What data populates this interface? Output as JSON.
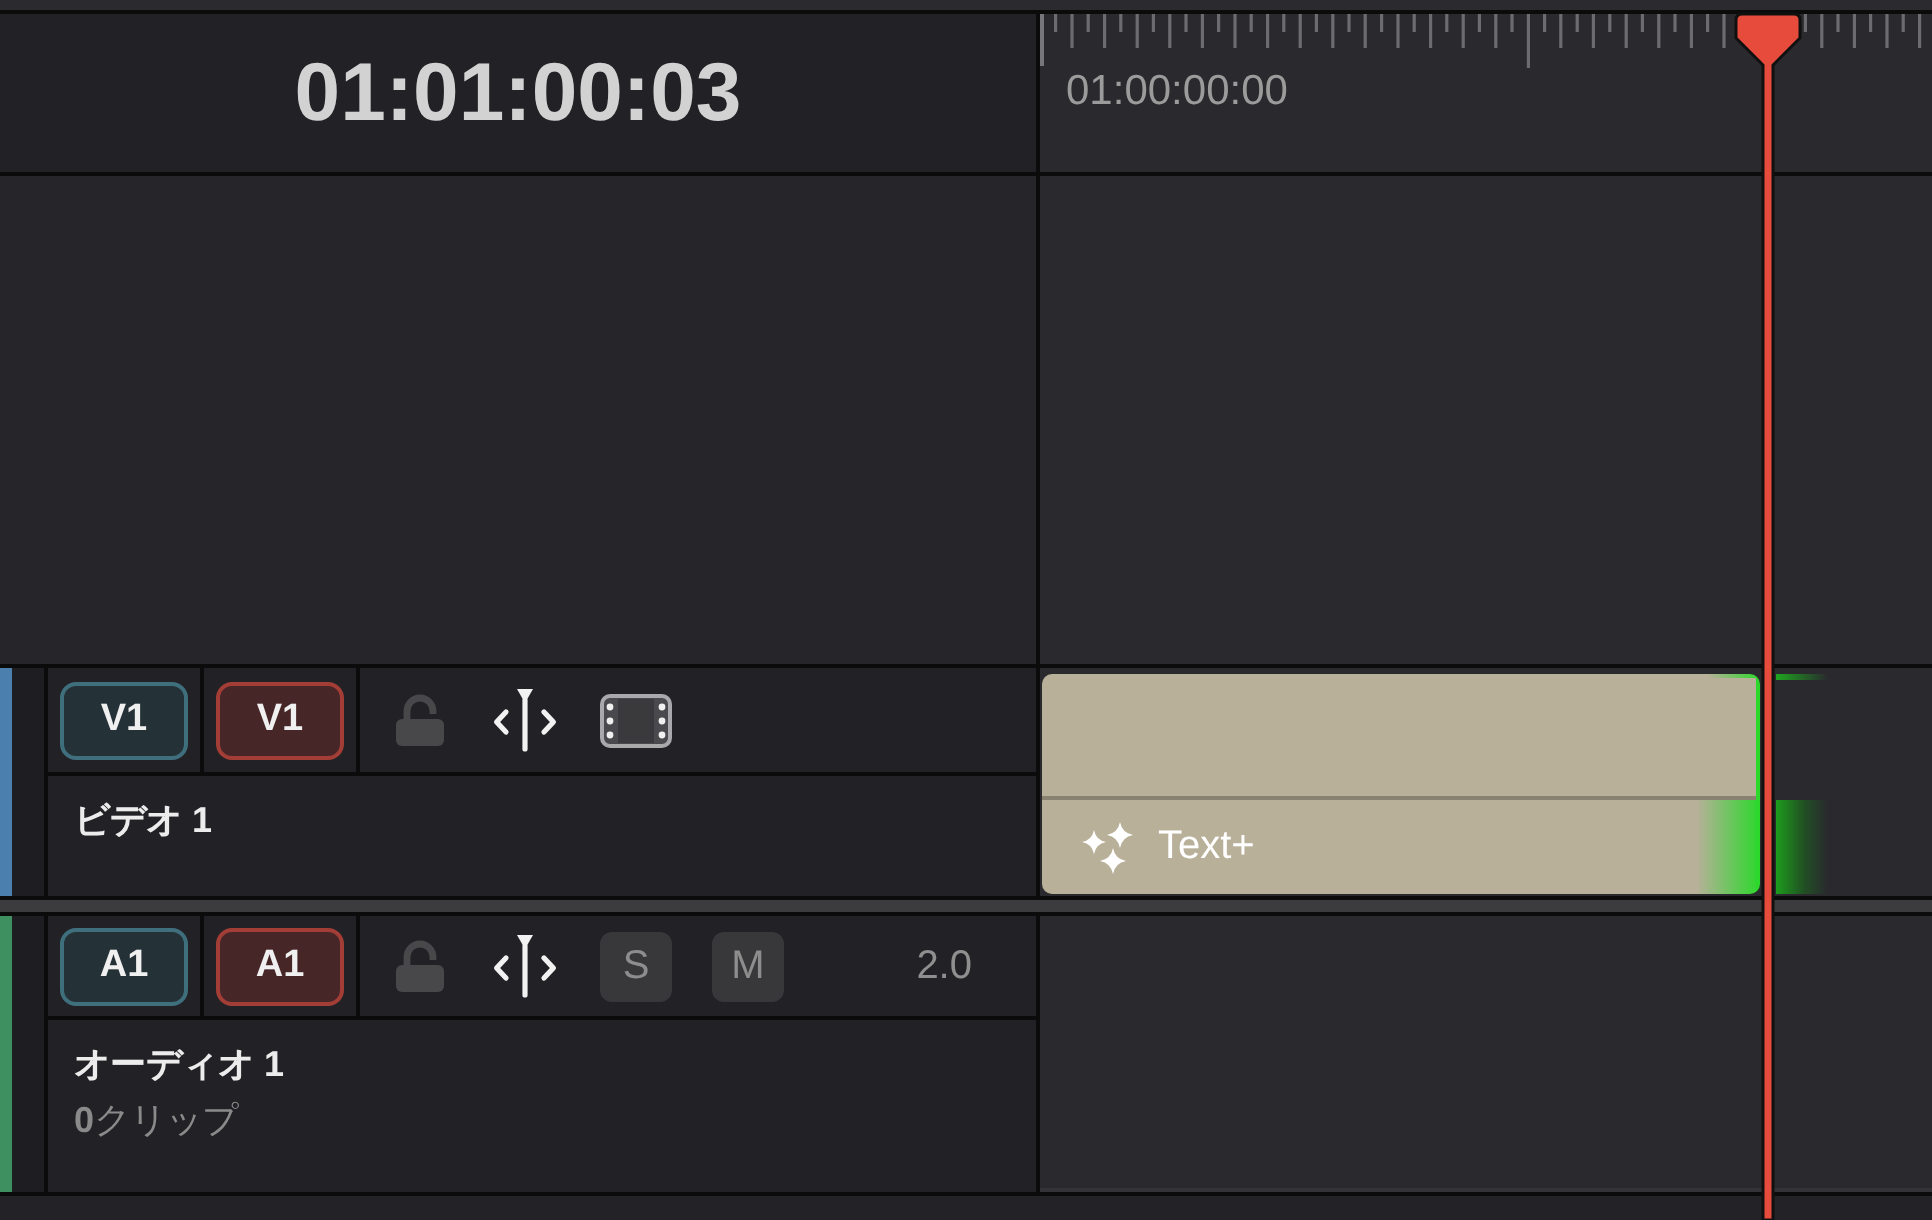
{
  "timecode": "01:01:00:03",
  "ruler": {
    "timecode": "01:00:00:00"
  },
  "tracks": [
    {
      "kind": "video",
      "color": "#4b7fae",
      "source_label": "V1",
      "destination_label": "V1",
      "locked": false,
      "name": "ビデオ 1",
      "clips": [
        {
          "kind": "title",
          "label": "Text+"
        }
      ]
    },
    {
      "kind": "audio",
      "color": "#3f9060",
      "source_label": "A1",
      "destination_label": "A1",
      "locked": false,
      "solo": {
        "label": "S",
        "on": false
      },
      "mute": {
        "label": "M",
        "on": false
      },
      "channels": "2.0",
      "name": "オーディオ 1",
      "clip_count": "**0**クリップ"
    }
  ]
}
